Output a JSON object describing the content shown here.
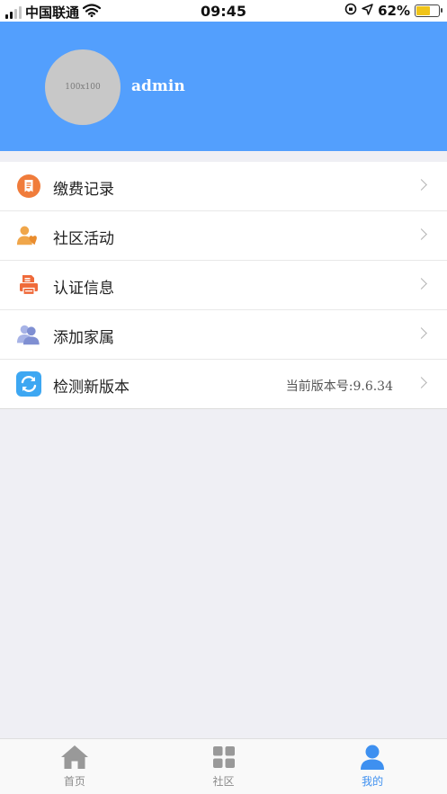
{
  "status_bar": {
    "carrier": "中国联通",
    "time": "09:45",
    "battery": "62%",
    "battery_level": 0.62,
    "battery_color": "#f0c419"
  },
  "profile": {
    "avatar_placeholder": "100x100",
    "username": "admin",
    "header_color": "#539ffd"
  },
  "menu": {
    "items": [
      {
        "label": "缴费记录",
        "icon": "bill-record-icon",
        "color": "#f07c3b"
      },
      {
        "label": "社区活动",
        "icon": "community-people-icon",
        "color": "#f0a64a"
      },
      {
        "label": "认证信息",
        "icon": "certification-printer-icon",
        "color": "#ef6a3a"
      },
      {
        "label": "添加家属",
        "icon": "add-family-icon",
        "color": "#8f9fda"
      },
      {
        "label": "检测新版本",
        "icon": "update-refresh-icon",
        "color": "#3da7f2",
        "extra": "当前版本号:9.6.34"
      }
    ]
  },
  "tabbar": {
    "tabs": [
      {
        "label": "首页",
        "icon": "home-icon"
      },
      {
        "label": "社区",
        "icon": "grid-icon"
      },
      {
        "label": "我的",
        "icon": "user-icon",
        "active": true
      }
    ],
    "active_color": "#3e90f0",
    "inactive_color": "#8a8a8a"
  }
}
